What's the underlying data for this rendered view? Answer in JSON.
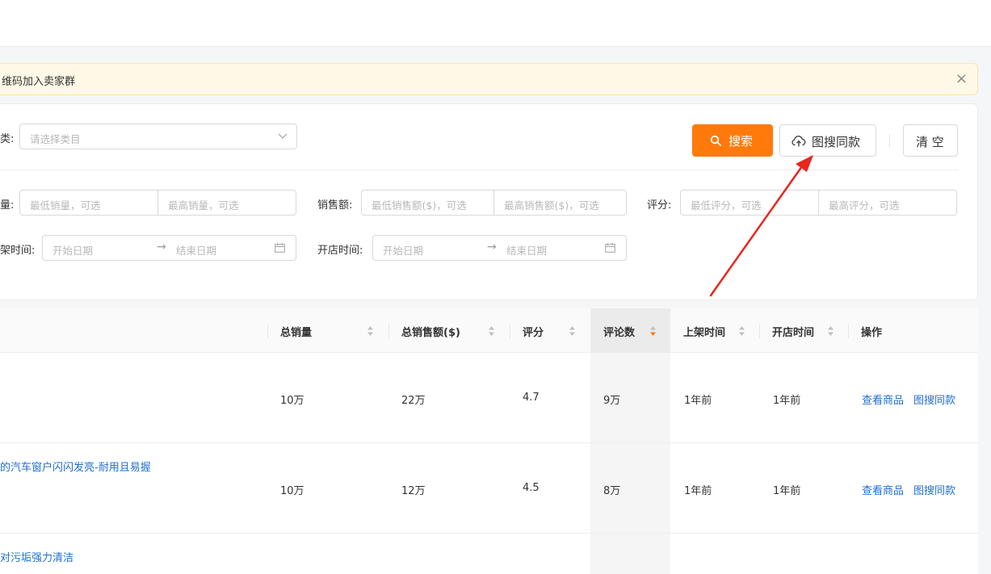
{
  "notice": {
    "text": "维码加入卖家群",
    "close_icon": "×"
  },
  "filters": {
    "category": {
      "label": "类:",
      "placeholder": "请选择类目"
    },
    "sales": {
      "label": "量:",
      "min_placeholder": "最低销量，可选",
      "max_placeholder": "最高销量，可选"
    },
    "revenue": {
      "label": "销售额:",
      "min_placeholder": "最低销售额($)，可选",
      "max_placeholder": "最高销售额($)，可选"
    },
    "rating": {
      "label": "评分:",
      "min_placeholder": "最低评分，可选",
      "max_placeholder": "最高评分，可选"
    },
    "listed_time": {
      "label": "架时间:",
      "start_placeholder": "开始日期",
      "end_placeholder": "结束日期"
    },
    "shop_time": {
      "label": "开店时间:",
      "start_placeholder": "开始日期",
      "end_placeholder": "结束日期"
    },
    "date_arrow": "→"
  },
  "buttons": {
    "search": "搜索",
    "image_search": "图搜同款",
    "clear": "清 空"
  },
  "table": {
    "columns": {
      "total_sales": "总销量",
      "total_revenue": "总销售额($)",
      "rating": "评分",
      "reviews": "评论数",
      "listed_time": "上架时间",
      "shop_time": "开店时间",
      "actions": "操作"
    },
    "rows": [
      {
        "title": "",
        "total_sales": "10万",
        "total_revenue": "22万",
        "rating": "4.7",
        "reviews": "9万",
        "listed_time": "1年前",
        "shop_time": "1年前",
        "view": "查看商品",
        "image_search": "图搜同款"
      },
      {
        "title": "的汽车窗户闪闪发亮-耐用且易握",
        "total_sales": "10万",
        "total_revenue": "12万",
        "rating": "4.5",
        "reviews": "8万",
        "listed_time": "1年前",
        "shop_time": "1年前",
        "view": "查看商品",
        "image_search": "图搜同款"
      },
      {
        "title": "对污垢强力清洁"
      }
    ]
  },
  "colors": {
    "accent_orange": "#ff7a0b",
    "link_blue": "#1f6fce",
    "annotation_red": "#e8261d",
    "notice_bg": "#fff8e6"
  },
  "icons": {
    "search_button": "search-icon",
    "image_search_button": "cloud-upload-icon",
    "category_select": "chevron-down-icon",
    "date_range": "calendar-icon",
    "notice_close": "close-icon",
    "active_sort": "sort-desc-icon"
  }
}
